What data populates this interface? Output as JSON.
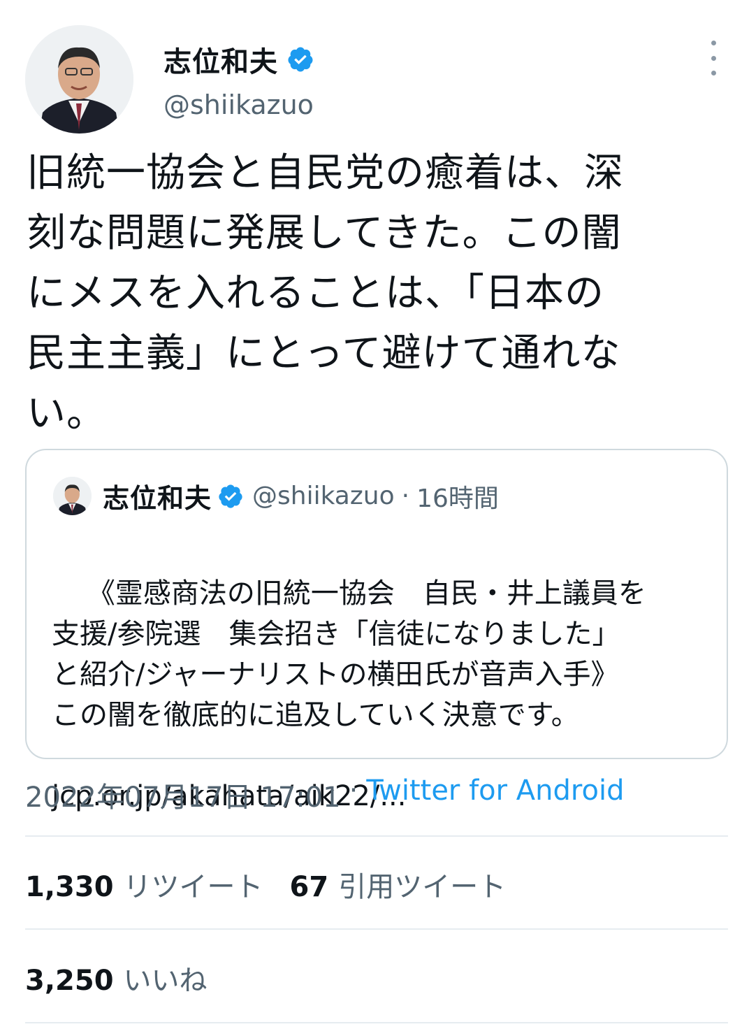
{
  "author": {
    "name": "志位和夫",
    "handle": "@shiikazuo"
  },
  "tweet_text": "旧統一協会と自民党の癒着は、深\n刻な問題に発展してきた。この闇\nにメスを入れることは、「日本の\n民主主義」にとって避けて通れな\nい。",
  "quoted_tweet": {
    "name": "志位和夫",
    "handle": "@shiikazuo",
    "separator": "·",
    "time": "16時間",
    "text": "《霊感商法の旧統一協会　自民・井上議員を\n支援/参院選　集会招き「信徒になりました」\nと紹介/ジャーナリストの横田氏が音声入手》\nこの闇を徹底的に追及していく決意です。",
    "link": "jcp.or.jp/akahata/aik22/..."
  },
  "meta": {
    "timestamp": "2022年07月17日 17:01",
    "separator": "·",
    "source": "Twitter for Android"
  },
  "stats": {
    "retweets_count": "1,330",
    "retweets_label": "リツイート",
    "quotes_count": "67",
    "quotes_label": "引用ツイート",
    "likes_count": "3,250",
    "likes_label": "いいね"
  },
  "colors": {
    "verified": "#1d9bf0",
    "link": "#1d9bf0",
    "muted": "#536471"
  }
}
